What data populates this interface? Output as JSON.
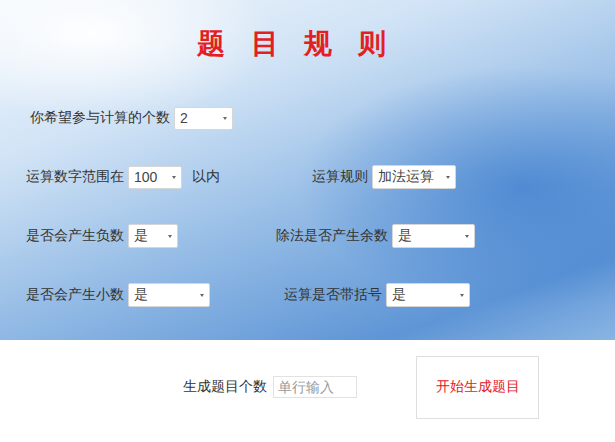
{
  "title": "题 目 规 则",
  "rows": [
    {
      "fields": [
        {
          "label": "你希望参与计算的个数",
          "value": "2"
        }
      ]
    },
    {
      "fields": [
        {
          "label": "运算数字范围在",
          "value": "100",
          "suffix": "以内"
        },
        {
          "label": "运算规则",
          "value": "加法运算"
        }
      ]
    },
    {
      "fields": [
        {
          "label": "是否会产生负数",
          "value": "是"
        },
        {
          "label": "除法是否产生余数",
          "value": "是"
        }
      ]
    },
    {
      "fields": [
        {
          "label": "是否会产生小数",
          "value": "是"
        },
        {
          "label": "运算是否带括号",
          "value": "是"
        }
      ]
    }
  ],
  "form": {
    "count_label": "生成题目个数",
    "count_placeholder": "单行输入",
    "submit": "开始生成题目"
  }
}
